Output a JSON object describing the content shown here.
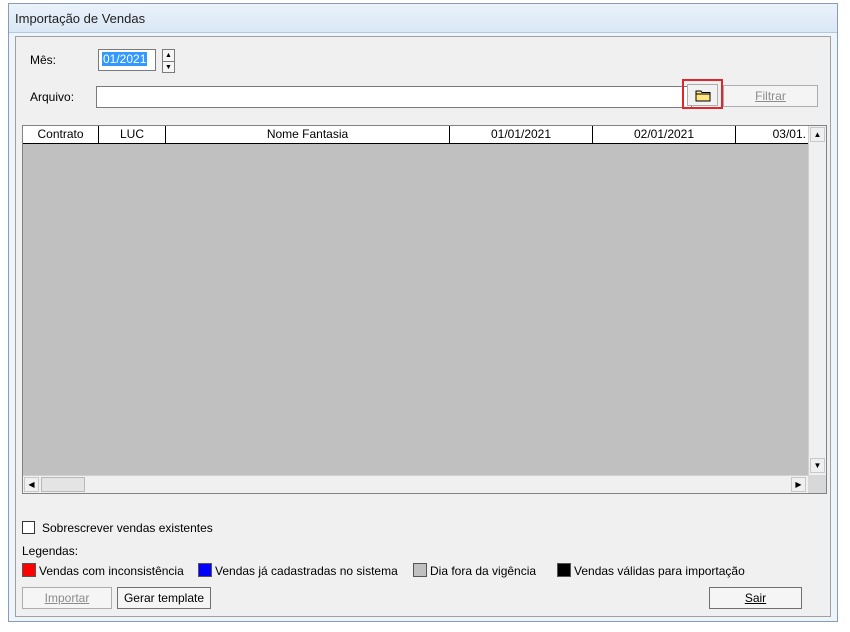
{
  "window": {
    "title": "Importação de Vendas"
  },
  "form": {
    "mes_label": "Mês:",
    "mes_value": "01/2021",
    "arquivo_label": "Arquivo:",
    "arquivo_value": "",
    "filtrar_label": "Filtrar"
  },
  "grid": {
    "columns": [
      "Contrato",
      "LUC",
      "Nome Fantasia",
      "01/01/2021",
      "02/01/2021",
      "03/01."
    ],
    "rows": []
  },
  "options": {
    "sobrescrever_label": "Sobrescrever vendas existentes",
    "sobrescrever_checked": false
  },
  "legend": {
    "title": "Legendas:",
    "items": [
      {
        "label": "Vendas com inconsistência",
        "color": "#ff0000"
      },
      {
        "label": "Vendas já cadastradas no sistema",
        "color": "#0000ff"
      },
      {
        "label": "Dia fora da vigência",
        "color": "#c0c0c0"
      },
      {
        "label": "Vendas válidas para importação",
        "color": "#000000"
      }
    ]
  },
  "buttons": {
    "importar": "Importar",
    "gerar_template": "Gerar template",
    "sair": "Sair"
  }
}
